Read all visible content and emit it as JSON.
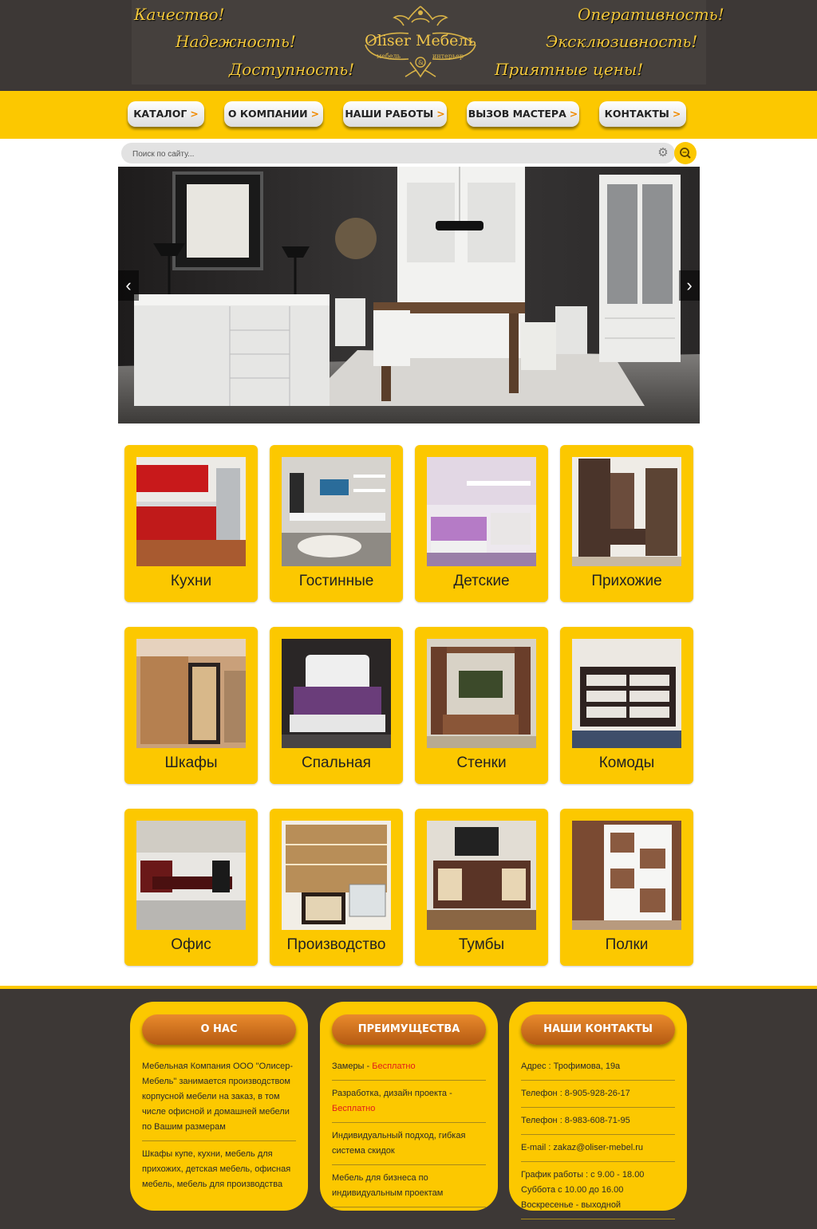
{
  "header": {
    "slogans_left": [
      "Качество!",
      "Надежность!",
      "Доступность!"
    ],
    "slogans_right": [
      "Оперативность!",
      "Эксклюзивность!",
      "Приятные цены!"
    ],
    "logo": {
      "name": "Oliser Мебель",
      "tagline_left": "мебель",
      "tagline_amp": "&",
      "tagline_right": "интерьер"
    }
  },
  "nav": {
    "items": [
      {
        "label": "КАТАЛОГ",
        "arrow": ">"
      },
      {
        "label": "О КОМПАНИИ",
        "arrow": ">"
      },
      {
        "label": "НАШИ РАБОТЫ",
        "arrow": ">"
      },
      {
        "label": "ВЫЗОВ МАСТЕРА",
        "arrow": ">"
      },
      {
        "label": "КОНТАКТЫ",
        "arrow": ">"
      }
    ]
  },
  "search": {
    "placeholder": "Поиск по сайту..."
  },
  "slider": {
    "prev": "‹",
    "next": "›"
  },
  "categories": [
    {
      "label": "Кухни"
    },
    {
      "label": "Гостинные"
    },
    {
      "label": "Детские"
    },
    {
      "label": "Прихожие"
    },
    {
      "label": "Шкафы"
    },
    {
      "label": "Спальная"
    },
    {
      "label": "Стенки"
    },
    {
      "label": "Комоды"
    },
    {
      "label": "Офис"
    },
    {
      "label": "Производство"
    },
    {
      "label": "Тумбы"
    },
    {
      "label": "Полки"
    }
  ],
  "footer": {
    "about": {
      "title": "О НАС",
      "paragraphs": [
        "Мебельная Компания ООО \"Олисер-Мебель\" занимается производством корпусной мебели на заказ, в том числе офисной и домашней мебели по Вашим размерам",
        "Шкафы купе, кухни, мебель для прихожих, детская мебель, офисная мебель, мебель для производства"
      ]
    },
    "advantages": {
      "title": "ПРЕИМУЩЕСТВА",
      "items": [
        {
          "text": "Замеры - ",
          "free": "Бесплатно"
        },
        {
          "text": "Разработка, дизайн проекта - ",
          "free": "Бесплатно"
        },
        {
          "text": "Индивидуальный подход, гибкая система скидок",
          "free": ""
        },
        {
          "text": "Мебель для бизнеса по индивидуальным проектам",
          "free": ""
        }
      ]
    },
    "contacts": {
      "title": "НАШИ КОНТАКТЫ",
      "address": "Адрес : Трофимова, 19а",
      "phone1": "Телефон : 8-905-928-26-17",
      "phone2": "Телефон : 8-983-608-71-95",
      "email": "E-mail : zakaz@oliser-mebel.ru",
      "hours1": "График работы : с 9.00 - 18.00",
      "hours2": "Суббота с 10.00 до 16.00",
      "hours3": "Воскресенье - выходной"
    }
  }
}
